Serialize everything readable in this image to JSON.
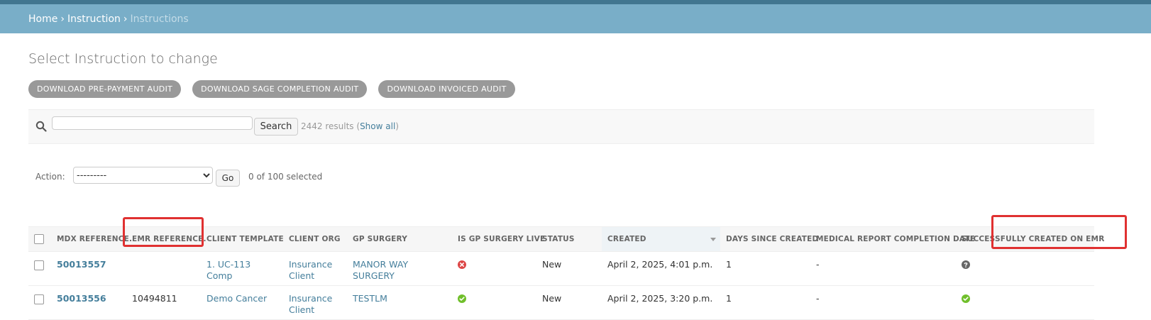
{
  "breadcrumbs": {
    "home": "Home",
    "section": "Instruction",
    "current": "Instructions",
    "sep": "›"
  },
  "page_title": "Select Instruction to change",
  "tools": [
    {
      "label": "DOWNLOAD PRE-PAYMENT AUDIT"
    },
    {
      "label": "DOWNLOAD SAGE COMPLETION AUDIT"
    },
    {
      "label": "DOWNLOAD INVOICED AUDIT"
    }
  ],
  "search": {
    "button": "Search",
    "results_count": "2442 results",
    "show_all": "Show all",
    "value": ""
  },
  "actions": {
    "label": "Action:",
    "selected_option": "---------",
    "go": "Go",
    "counter": "0 of 100 selected"
  },
  "table": {
    "columns": [
      "MDX REFERENCE.",
      "EMR REFERENCE.",
      "CLIENT TEMPLATE",
      "CLIENT ORG",
      "GP SURGERY",
      "IS GP SURGERY LIVE",
      "STATUS",
      "CREATED",
      "DAYS SINCE CREATED",
      "MEDICAL REPORT COMPLETION DATE",
      "SUCCESSFULLY CREATED ON EMR"
    ],
    "rows": [
      {
        "mdx_ref": "50013557",
        "emr_ref": "",
        "client_template": "1. UC-113 Comp",
        "client_org_1": "Insurance",
        "client_org_2": "Client",
        "gp_surgery": "MANOR WAY SURGERY",
        "gp_live": "no",
        "status": "New",
        "created": "April 2, 2025, 4:01 p.m.",
        "days_since": "1",
        "completion_date": "-",
        "emr_created": "unknown"
      },
      {
        "mdx_ref": "50013556",
        "emr_ref": "10494811",
        "client_template": "Demo Cancer",
        "client_org_1": "Insurance",
        "client_org_2": "Client",
        "gp_surgery": "TESTLM",
        "gp_live": "yes",
        "status": "New",
        "created": "April 2, 2025, 3:20 p.m.",
        "days_since": "1",
        "completion_date": "-",
        "emr_created": "yes"
      }
    ]
  },
  "colors": {
    "header_dark": "#417690",
    "breadcrumb_bar": "#79aec8",
    "link": "#447e9b",
    "highlight": "#e03131",
    "no_icon": "#dd4646",
    "yes_icon": "#70bf2b"
  }
}
